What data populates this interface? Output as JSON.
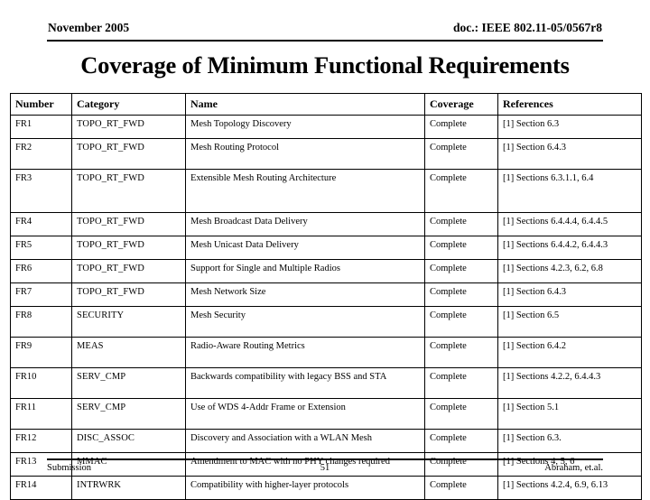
{
  "header": {
    "left": "November 2005",
    "right": "doc.: IEEE 802.11-05/0567r8"
  },
  "title": "Coverage of Minimum Functional Requirements",
  "table": {
    "columns": [
      "Number",
      "Category",
      "Name",
      "Coverage",
      "References"
    ],
    "rows": [
      {
        "number": "FR1",
        "category": "TOPO_RT_FWD",
        "name": "Mesh Topology Discovery",
        "coverage": "Complete",
        "references": "[1] Section 6.3"
      },
      {
        "number": "FR2",
        "category": "TOPO_RT_FWD",
        "name": "Mesh Routing Protocol",
        "coverage": "Complete",
        "references": "[1] Section 6.4.3"
      },
      {
        "number": "FR3",
        "category": "TOPO_RT_FWD",
        "name": "Extensible Mesh Routing Architecture",
        "coverage": "Complete",
        "references": "[1] Sections 6.3.1.1, 6.4"
      },
      {
        "number": "FR4",
        "category": "TOPO_RT_FWD",
        "name": "Mesh Broadcast Data Delivery",
        "coverage": "Complete",
        "references": "[1] Sections 6.4.4.4, 6.4.4.5"
      },
      {
        "number": "FR5",
        "category": "TOPO_RT_FWD",
        "name": "Mesh Unicast Data Delivery",
        "coverage": "Complete",
        "references": "[1] Sections 6.4.4.2, 6.4.4.3"
      },
      {
        "number": "FR6",
        "category": "TOPO_RT_FWD",
        "name": "Support for Single and Multiple Radios",
        "coverage": "Complete",
        "references": "[1] Sections 4.2.3, 6.2, 6.8"
      },
      {
        "number": "FR7",
        "category": "TOPO_RT_FWD",
        "name": "Mesh Network Size",
        "coverage": "Complete",
        "references": "[1] Section 6.4.3"
      },
      {
        "number": "FR8",
        "category": "SECURITY",
        "name": "Mesh Security",
        "coverage": "Complete",
        "references": "[1] Section 6.5"
      },
      {
        "number": "FR9",
        "category": "MEAS",
        "name": "Radio-Aware Routing Metrics",
        "coverage": "Complete",
        "references": "[1] Section 6.4.2"
      },
      {
        "number": "FR10",
        "category": "SERV_CMP",
        "name": "Backwards compatibility with legacy BSS and STA",
        "coverage": "Complete",
        "references": "[1] Sections 4.2.2, 6.4.4.3"
      },
      {
        "number": "FR11",
        "category": "SERV_CMP",
        "name": "Use of WDS 4-Addr Frame or Extension",
        "coverage": "Complete",
        "references": "[1] Section 5.1"
      },
      {
        "number": "FR12",
        "category": "DISC_ASSOC",
        "name": "Discovery and Association with a WLAN Mesh",
        "coverage": "Complete",
        "references": "[1] Section 6.3."
      },
      {
        "number": "FR13",
        "category": "MMAC",
        "name": "Amendment to MAC with no PHY changes required",
        "coverage": "Complete",
        "references": "[1] Sections 4, 5, 6"
      },
      {
        "number": "FR14",
        "category": "INTRWRK",
        "name": "Compatibility with higher-layer protocols",
        "coverage": "Complete",
        "references": "[1] Sections 4.2.4, 6.9, 6.13"
      }
    ]
  },
  "footer": {
    "left": "Submission",
    "center": "51",
    "right": "Abraham, et.al."
  }
}
